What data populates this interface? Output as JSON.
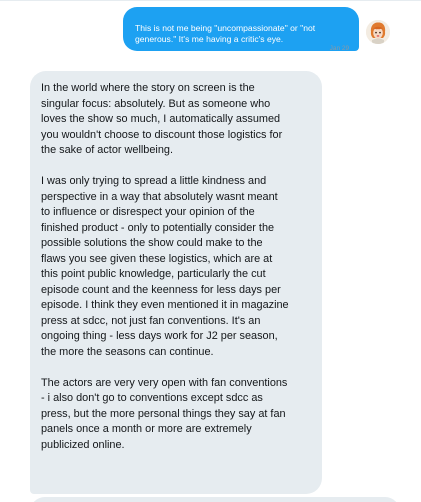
{
  "thread": {
    "outgoing": {
      "text": "This is not me being \"uncompassionate\" or \"not\ngenerous.\" It's me having a critic's eye.",
      "date": "Jan 29",
      "status_icon": "check-icon"
    },
    "incoming": {
      "paragraphs": [
        "In the world where the story on screen is the\nsingular focus: absolutely. But as someone who\nloves the show so much, I automatically assumed\nyou wouldn't choose to discount those logistics for\nthe sake of actor wellbeing.",
        "I was only trying to spread a little kindness and\nperspective in a way that absolutely wasnt meant\nto influence or disrespect your opinion of the\nfinished product - only to potentially consider the\npossible solutions the show could make to the\nflaws you see given these logistics, which are at\nthis point public knowledge, particularly the cut\nepisode count and the keenness for less days per\nepisode. I think they even mentioned it in magazine\npress at sdcc, not just fan conventions. It's an\nongoing thing - less days work for J2 per season,\nthe more the seasons can continue.",
        "The actors are very very open with fan conventions\n- i also don't go to conventions except sdcc as\npress, but the more personal things they say at fan\npanels once a month or more are extremely\npublicized online."
      ]
    }
  },
  "colors": {
    "outgoing_bubble": "#1da1f2",
    "incoming_bubble": "#e6ecf0",
    "meta_text": "#8899a6"
  }
}
